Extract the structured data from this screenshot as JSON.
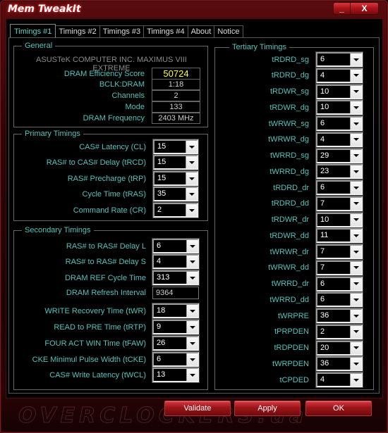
{
  "window": {
    "title": "Mem TweakIt",
    "minimize_label": "_",
    "close_label": "X"
  },
  "tabs": [
    {
      "label": "Timings #1",
      "active": true
    },
    {
      "label": "Timings #2",
      "active": false
    },
    {
      "label": "Timings #3",
      "active": false
    },
    {
      "label": "Timings #4",
      "active": false
    },
    {
      "label": "About",
      "active": false
    },
    {
      "label": "Notice",
      "active": false
    }
  ],
  "general": {
    "title": "General",
    "motherboard": "ASUSTeK COMPUTER INC. MAXIMUS VIII EXTREME",
    "fields": [
      {
        "label": "DRAM Efficiency Score",
        "value": "50724"
      },
      {
        "label": "BCLK:DRAM",
        "value": "1:18"
      },
      {
        "label": "Channels",
        "value": "2"
      },
      {
        "label": "Mode",
        "value": "133"
      },
      {
        "label": "DRAM Frequency",
        "value": "2403 MHz"
      }
    ]
  },
  "primary": {
    "title": "Primary Timings",
    "items": [
      {
        "label": "CAS# Latency (CL)",
        "value": "15"
      },
      {
        "label": "RAS# to CAS# Delay (tRCD)",
        "value": "15"
      },
      {
        "label": "RAS# Precharge (tRP)",
        "value": "15"
      },
      {
        "label": "Cycle Time (tRAS)",
        "value": "35"
      },
      {
        "label": "Command Rate (CR)",
        "value": "2"
      }
    ]
  },
  "secondary": {
    "title": "Secondary Timings",
    "items": [
      {
        "label": "RAS# to RAS# Delay L",
        "value": "6"
      },
      {
        "label": "RAS# to RAS# Delay S",
        "value": "4"
      },
      {
        "label": "DRAM REF Cycle Time",
        "value": "313"
      },
      {
        "label": "DRAM Refresh Interval",
        "value": "9364"
      },
      {
        "label": "WRITE Recovery Time (tWR)",
        "value": "18"
      },
      {
        "label": "READ to PRE Time (tRTP)",
        "value": "9"
      },
      {
        "label": "FOUR ACT WIN Time (tFAW)",
        "value": "26"
      },
      {
        "label": "CKE Minimul Pulse Width (tCKE)",
        "value": "6"
      },
      {
        "label": "CAS# Write Latency (tWCL)",
        "value": "13"
      }
    ]
  },
  "tertiary": {
    "title": "Tertiary Timings",
    "items": [
      {
        "label": "tRDRD_sg",
        "value": "6"
      },
      {
        "label": "tRDRD_dg",
        "value": "4"
      },
      {
        "label": "tRDWR_sg",
        "value": "10"
      },
      {
        "label": "tRDWR_dg",
        "value": "10"
      },
      {
        "label": "tWRWR_sg",
        "value": "6"
      },
      {
        "label": "tWRWR_dg",
        "value": "4"
      },
      {
        "label": "tWRRD_sg",
        "value": "29"
      },
      {
        "label": "tWRRD_dg",
        "value": "23"
      },
      {
        "label": "tRDRD_dr",
        "value": "6"
      },
      {
        "label": "tRDRD_dd",
        "value": "7"
      },
      {
        "label": "tRDWR_dr",
        "value": "10"
      },
      {
        "label": "tRDWR_dd",
        "value": "11"
      },
      {
        "label": "tWRWR_dr",
        "value": "7"
      },
      {
        "label": "tWRWR_dd",
        "value": "7"
      },
      {
        "label": "tWRRD_dr",
        "value": "6"
      },
      {
        "label": "tWRRD_dd",
        "value": "6"
      },
      {
        "label": "tWRPRE",
        "value": "36"
      },
      {
        "label": "tPRPDEN",
        "value": "2"
      },
      {
        "label": "tRDPDEN",
        "value": "20"
      },
      {
        "label": "tWRPDEN",
        "value": "36"
      },
      {
        "label": "tCPDED",
        "value": "4"
      }
    ]
  },
  "footer": {
    "validate_label": "Validate",
    "apply_label": "Apply",
    "ok_label": "OK",
    "watermark": "OVERCLOCKERS.ua"
  },
  "colors": {
    "label": "#52c3bd",
    "score": "#ffff3a",
    "accent": "#a81418"
  }
}
